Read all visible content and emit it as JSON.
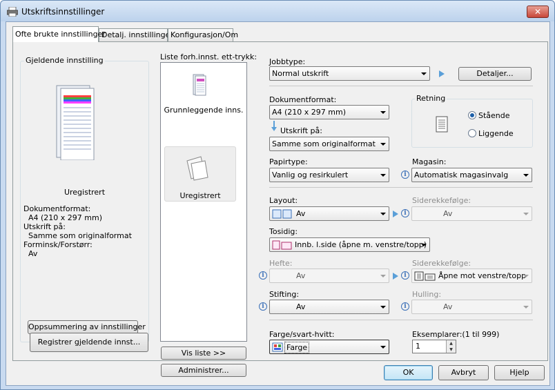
{
  "window": {
    "title": "Utskriftsinnstillinger",
    "close_label": "✕"
  },
  "tabs": [
    {
      "label": "Ofte brukte innstillinger"
    },
    {
      "label": "Detalj. innstillinger"
    },
    {
      "label": "Konfigurasjon/Om"
    }
  ],
  "current_setting": {
    "group_label": "Gjeldende innstilling",
    "name": "Uregistrert",
    "lines": [
      "Dokumentformat:",
      "  A4 (210 x 297 mm)",
      "Utskrift på:",
      "  Samme som originalformat",
      "Forminsk/Forstørr:",
      "  Av"
    ],
    "summary_button": "Oppsummering av innstillinger",
    "register_button": "Registrer gjeldende innst..."
  },
  "preset_list": {
    "label": "Liste forh.innst. ett-trykk:",
    "items": [
      {
        "label": "Grunnleggende inns."
      },
      {
        "label": "Uregistrert"
      }
    ],
    "show_list_button": "Vis liste >>",
    "manage_button": "Administrer..."
  },
  "job_type": {
    "label": "Jobbtype:",
    "value": "Normal utskrift",
    "details_button": "Detaljer..."
  },
  "doc_size": {
    "label": "Dokumentformat:",
    "value": "A4 (210 x 297 mm)"
  },
  "print_on": {
    "label": "Utskrift på:",
    "value": "Samme som originalformat"
  },
  "orientation": {
    "label": "Retning",
    "portrait": "Stående",
    "landscape": "Liggende",
    "selected": "portrait"
  },
  "paper_type": {
    "label": "Papirtype:",
    "value": "Vanlig og resirkulert"
  },
  "tray": {
    "label": "Magasin:",
    "value": "Automatisk magasinvalg"
  },
  "layout": {
    "label": "Layout:",
    "value": "Av"
  },
  "page_order_1": {
    "label": "Siderekkefølge:",
    "value": "Av"
  },
  "duplex": {
    "label": "Tosidig:",
    "value": "Innb. l.side (åpne m. venstre/topp)"
  },
  "staple": {
    "label": "Hefte:",
    "value": "Av"
  },
  "page_order_2": {
    "label": "Siderekkefølge:",
    "value": "Åpne mot venstre/topp"
  },
  "stapling": {
    "label": "Stifting:",
    "value": "Av"
  },
  "punch": {
    "label": "Hulling:",
    "value": "Av"
  },
  "color_mode": {
    "label": "Farge/svart-hvitt:",
    "value": "Farge"
  },
  "copies": {
    "label": "Eksemplarer:(1 til 999)",
    "value": "1"
  },
  "footer": {
    "ok": "OK",
    "cancel": "Avbryt",
    "help": "Hjelp"
  },
  "info_glyph": "i"
}
